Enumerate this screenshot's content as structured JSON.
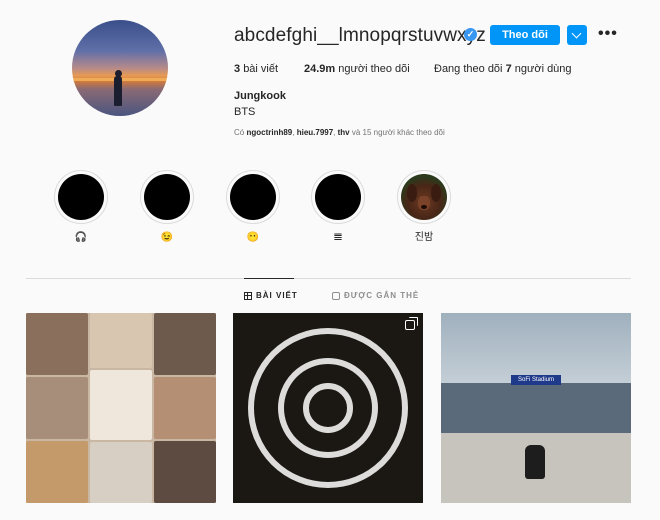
{
  "profile": {
    "username": "abcdefghi__lmnopqrstuvwxyz",
    "verified_badge": "check-icon",
    "follow_label": "Theo dõi",
    "fullname": "Jungkook",
    "bio": "BTS"
  },
  "stats": {
    "posts_count": "3",
    "posts_label": "bài viết",
    "followers_count": "24.9m",
    "followers_label": "người theo dõi",
    "following_prefix": "Đang theo dõi",
    "following_count": "7",
    "following_suffix": "người dùng"
  },
  "followed_by": {
    "prefix": "Có",
    "names": [
      "ngoctrinh89",
      "hieu.7997",
      "thv"
    ],
    "suffix": "và 15 người khác theo dõi"
  },
  "highlights": [
    {
      "label": "🎧"
    },
    {
      "label": "😉"
    },
    {
      "label": "😶"
    },
    {
      "label": "𝌆"
    },
    {
      "label": "진밤"
    }
  ],
  "tabs": {
    "posts": "BÀI VIẾT",
    "tagged": "ĐƯỢC GẮN THẺ"
  },
  "colors": {
    "accent": "#0095f6",
    "text": "#262626",
    "muted": "#8e8e8e",
    "background": "#fafafa"
  }
}
